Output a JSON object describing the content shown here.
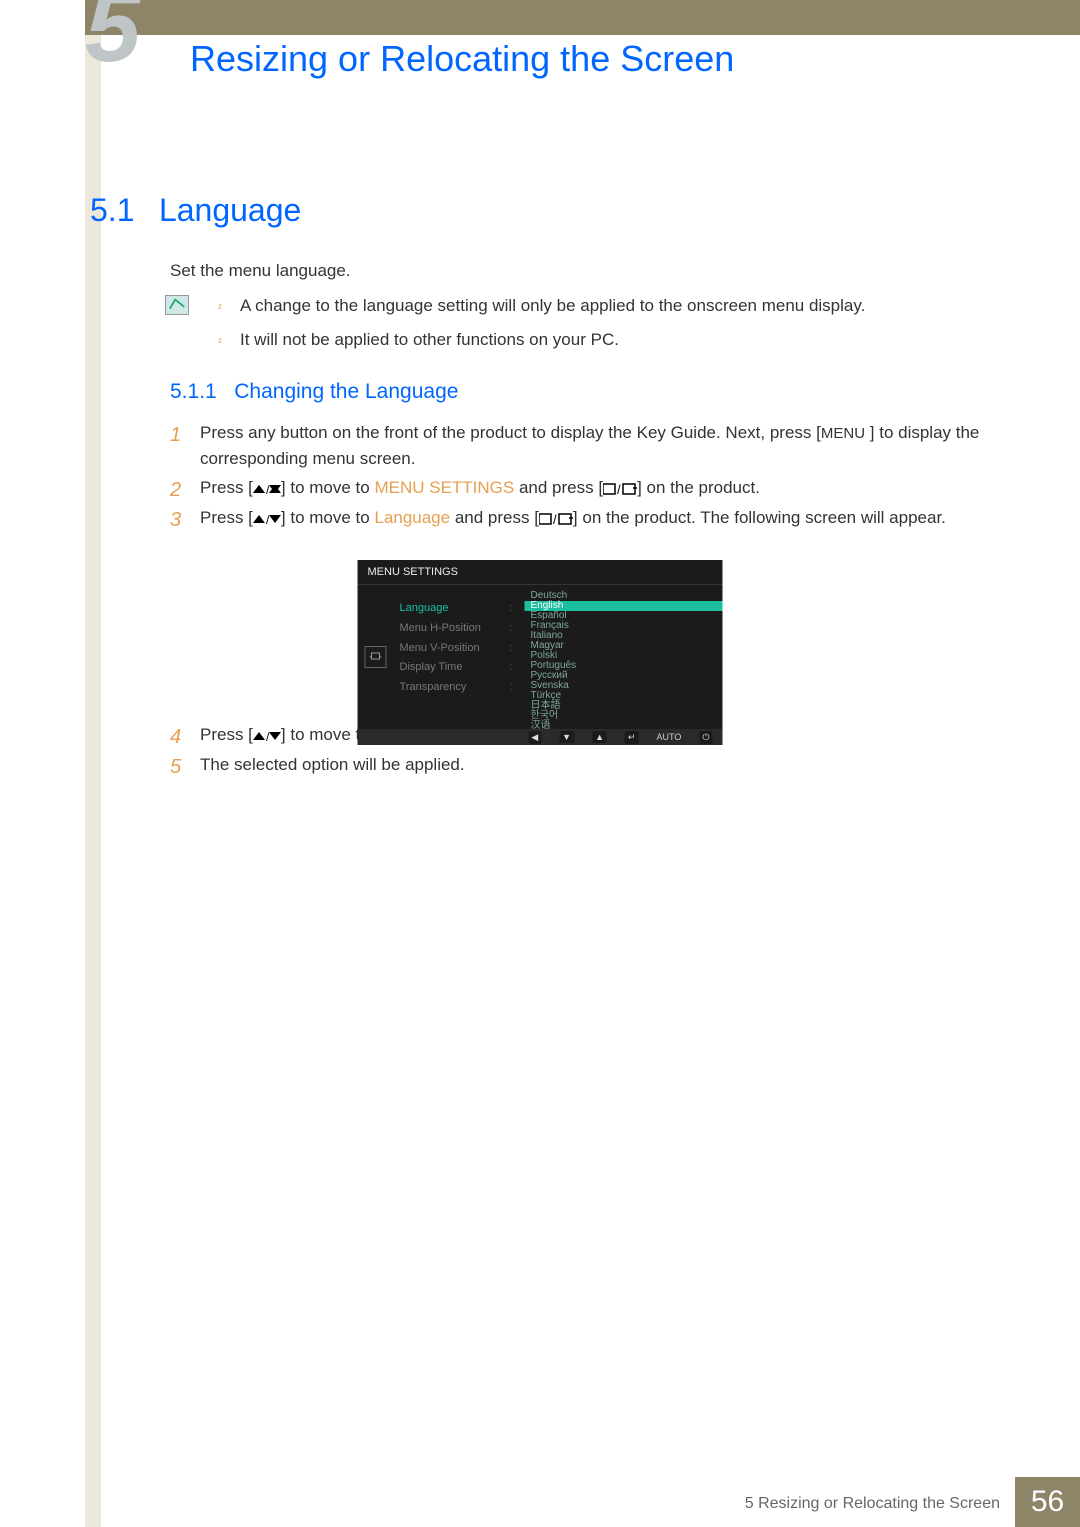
{
  "chapter": {
    "number": "5",
    "title": "Resizing or Relocating the Screen",
    "footer_label": "5 Resizing or Relocating the Screen",
    "page": "56"
  },
  "section": {
    "number": "5.1",
    "title": "Language",
    "intro": "Set the menu language.",
    "notes": [
      "A change to the language setting will only be applied to the onscreen menu display.",
      "It will not be applied to other functions on your PC."
    ]
  },
  "subsection": {
    "number": "5.1.1",
    "title": "Changing the Language"
  },
  "steps": {
    "s1a": "Press any button on the front of the product to display the Key Guide. Next, press ",
    "s1_menu": "MENU",
    "s1b": " ] to display the corresponding menu screen.",
    "s2a": "Press [",
    "s2b": "] to move to ",
    "s2_menu_settings": "MENU SETTINGS",
    "s2c": " and press [",
    "s2d": "] on the product.",
    "s3a": "Press [",
    "s3b": "] to move to ",
    "s3_language": "Language",
    "s3c": " and press [",
    "s3d": "] on the product. The following screen will appear.",
    "s4a": "Press [",
    "s4b": "] to move to the language you want and press [",
    "s4c": "].",
    "s5": "The selected option will be applied."
  },
  "osd": {
    "title": "MENU SETTINGS",
    "labels": [
      "Language",
      "Menu H-Position",
      "Menu V-Position",
      "Display Time",
      "Transparency"
    ],
    "languages": [
      "Deutsch",
      "English",
      "Español",
      "Français",
      "Italiano",
      "Magyar",
      "Polski",
      "Português",
      "Русский",
      "Svenska",
      "Türkçe",
      "日本語",
      "한국어",
      "汉语"
    ],
    "selected_language": "English",
    "bottom_auto": "AUTO"
  }
}
